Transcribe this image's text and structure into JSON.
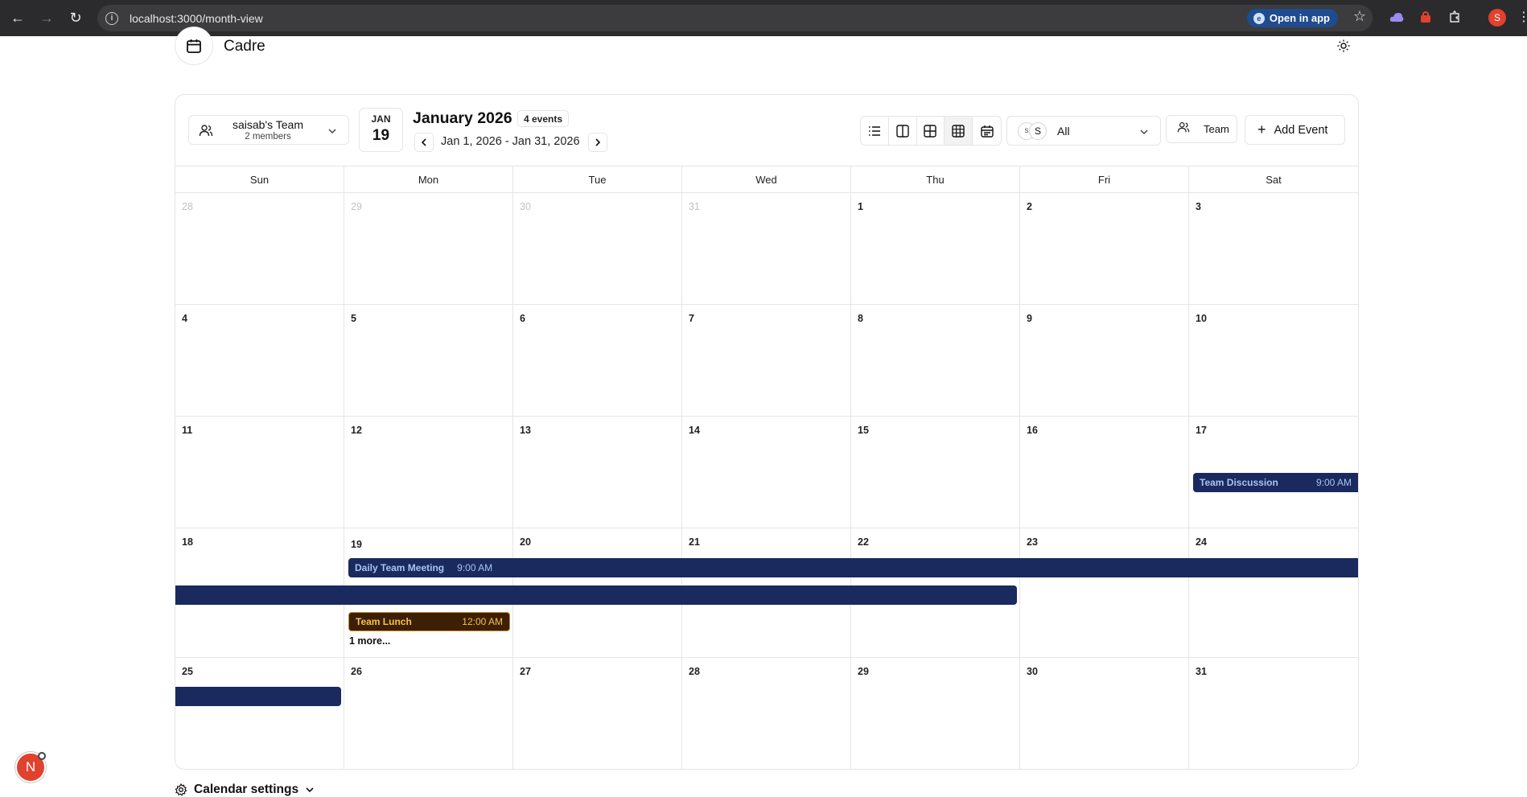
{
  "browser": {
    "url": "localhost:3000/month-view",
    "open_in_app": "Open in app",
    "profile_initial": "S"
  },
  "app": {
    "name": "Cadre"
  },
  "toolbar": {
    "team_name": "saisab's Team",
    "team_members": "2 members",
    "date_month": "JAN",
    "date_day": "19",
    "month_title": "January 2026",
    "events_count": "4 events",
    "range": "Jan 1, 2026 - Jan 31, 2026",
    "user_filter": "All",
    "avatar_1": "s",
    "avatar_2": "S",
    "team_button": "Team",
    "add_event": "Add Event"
  },
  "calendar": {
    "weekdays": [
      "Sun",
      "Mon",
      "Tue",
      "Wed",
      "Thu",
      "Fri",
      "Sat"
    ],
    "weeks": [
      [
        "28",
        "29",
        "30",
        "31",
        "1",
        "2",
        "3"
      ],
      [
        "4",
        "5",
        "6",
        "7",
        "8",
        "9",
        "10"
      ],
      [
        "11",
        "12",
        "13",
        "14",
        "15",
        "16",
        "17"
      ],
      [
        "18",
        "19",
        "20",
        "21",
        "22",
        "23",
        "24"
      ],
      [
        "25",
        "26",
        "27",
        "28",
        "29",
        "30",
        "31"
      ]
    ],
    "events": {
      "team_discussion": {
        "title": "Team Discussion",
        "time": "9:00 AM"
      },
      "daily_meeting": {
        "title": "Daily Team Meeting",
        "time": "9:00 AM"
      },
      "team_lunch": {
        "title": "Team Lunch",
        "time": "12:00 AM"
      }
    },
    "more_link": "1 more..."
  },
  "footer": {
    "settings_label": "Calendar settings",
    "badge_initial": "N"
  },
  "colors": {
    "event_navy": "#1a2a5e",
    "event_brown": "#3d1f05",
    "accent_red": "#e0422e"
  }
}
